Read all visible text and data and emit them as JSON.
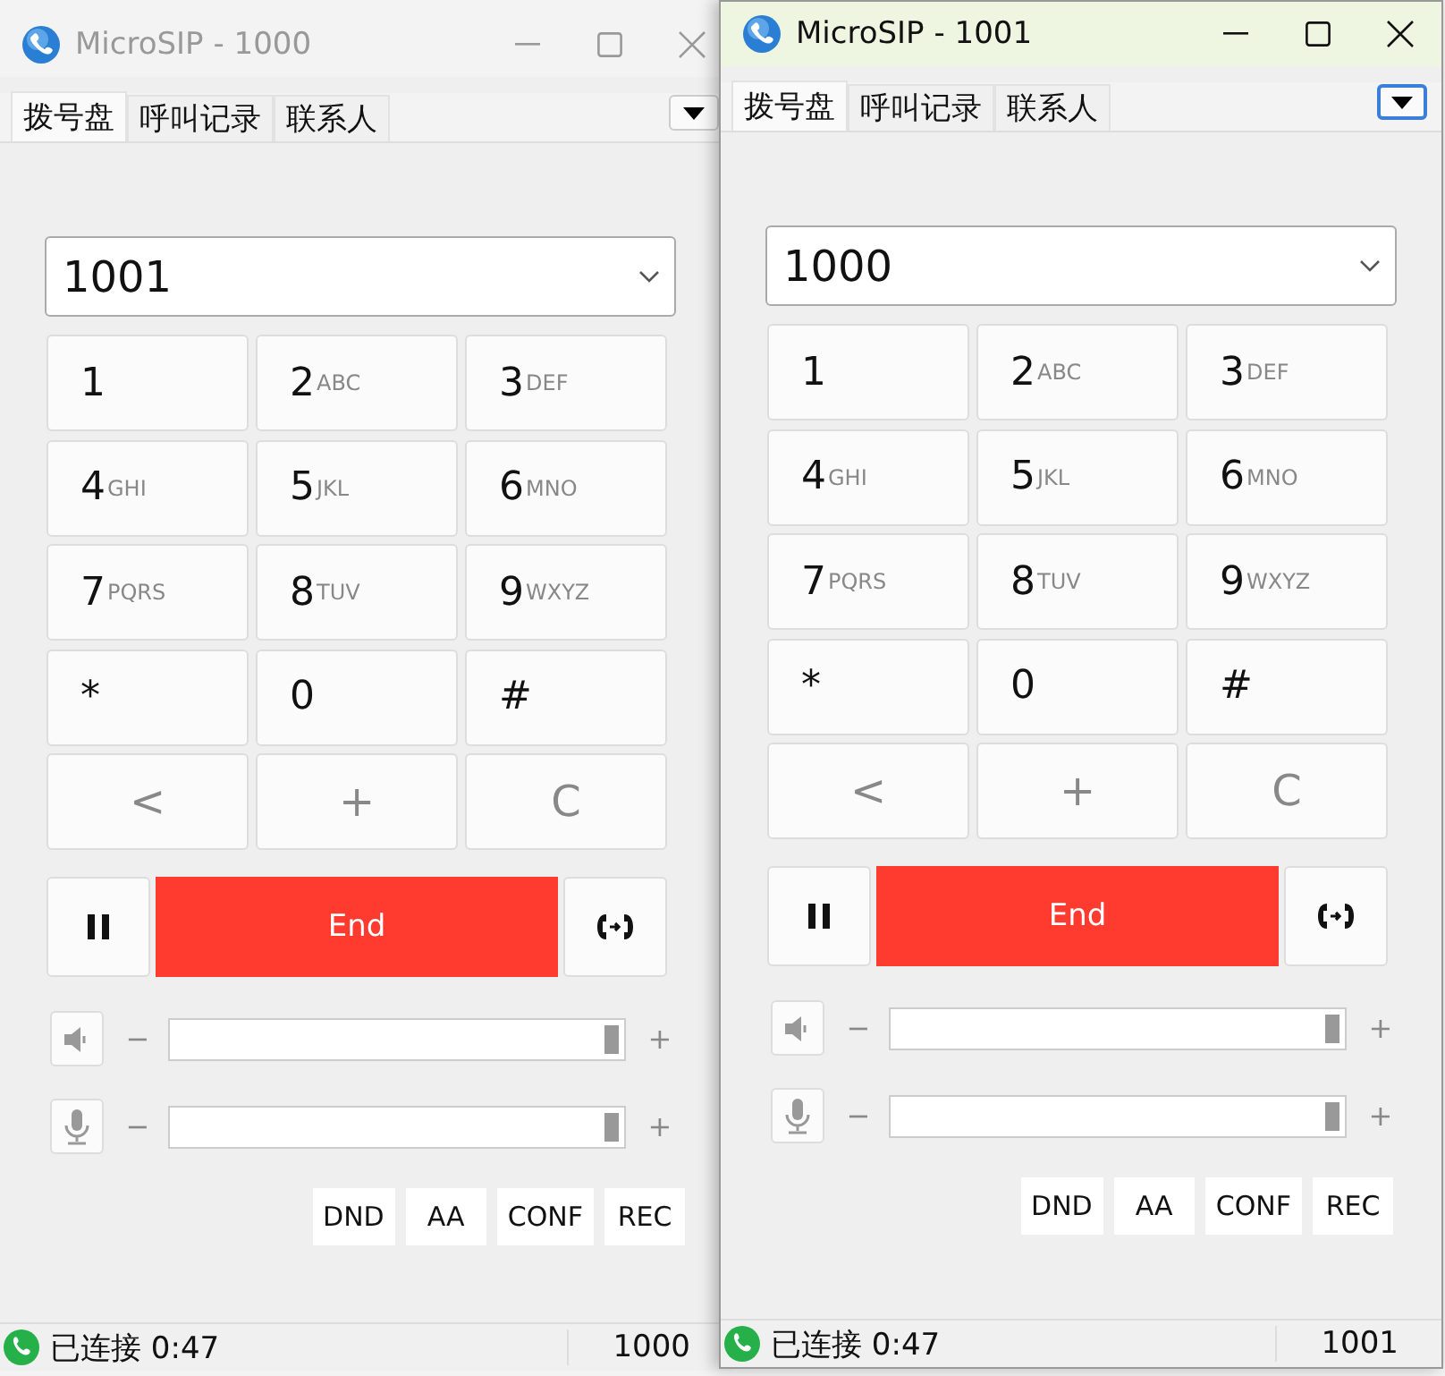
{
  "windows": [
    {
      "title": "MicroSIP - 1000",
      "active": false,
      "tabs": [
        {
          "label": "拨号盘",
          "selected": true
        },
        {
          "label": "呼叫记录",
          "selected": false
        },
        {
          "label": "联系人",
          "selected": false
        }
      ],
      "dial_input": {
        "value": "1001"
      },
      "keypad": [
        {
          "kind": "digit",
          "digit": "1"
        },
        {
          "kind": "digit",
          "digit": "2",
          "letters": "ABC"
        },
        {
          "kind": "digit",
          "digit": "3",
          "letters": "DEF"
        },
        {
          "kind": "digit",
          "digit": "4",
          "letters": "GHI"
        },
        {
          "kind": "digit",
          "digit": "5",
          "letters": "JKL"
        },
        {
          "kind": "digit",
          "digit": "6",
          "letters": "MNO"
        },
        {
          "kind": "digit",
          "digit": "7",
          "letters": "PQRS"
        },
        {
          "kind": "digit",
          "digit": "8",
          "letters": "TUV"
        },
        {
          "kind": "digit",
          "digit": "9",
          "letters": "WXYZ"
        },
        {
          "kind": "digit",
          "digit": "*"
        },
        {
          "kind": "digit",
          "digit": "0"
        },
        {
          "kind": "digit",
          "digit": "#"
        },
        {
          "kind": "function",
          "digit": "<"
        },
        {
          "kind": "function",
          "digit": "+"
        },
        {
          "kind": "function",
          "digit": "C"
        }
      ],
      "end_button": "End",
      "volumes": [
        {
          "kind": "speaker",
          "minus": "−",
          "plus": "+",
          "level": 1
        },
        {
          "kind": "microphone",
          "minus": "−",
          "plus": "+",
          "level": 1
        }
      ],
      "feature_buttons": [
        "DND",
        "AA",
        "CONF",
        "REC"
      ],
      "status": {
        "text": "已连接 0:47",
        "account": "1000"
      }
    },
    {
      "title": "MicroSIP - 1001",
      "active": true,
      "tabs": [
        {
          "label": "拨号盘",
          "selected": true
        },
        {
          "label": "呼叫记录",
          "selected": false
        },
        {
          "label": "联系人",
          "selected": false
        }
      ],
      "dial_input": {
        "value": "1000"
      },
      "keypad": [
        {
          "kind": "digit",
          "digit": "1"
        },
        {
          "kind": "digit",
          "digit": "2",
          "letters": "ABC"
        },
        {
          "kind": "digit",
          "digit": "3",
          "letters": "DEF"
        },
        {
          "kind": "digit",
          "digit": "4",
          "letters": "GHI"
        },
        {
          "kind": "digit",
          "digit": "5",
          "letters": "JKL"
        },
        {
          "kind": "digit",
          "digit": "6",
          "letters": "MNO"
        },
        {
          "kind": "digit",
          "digit": "7",
          "letters": "PQRS"
        },
        {
          "kind": "digit",
          "digit": "8",
          "letters": "TUV"
        },
        {
          "kind": "digit",
          "digit": "9",
          "letters": "WXYZ"
        },
        {
          "kind": "digit",
          "digit": "*"
        },
        {
          "kind": "digit",
          "digit": "0"
        },
        {
          "kind": "digit",
          "digit": "#"
        },
        {
          "kind": "function",
          "digit": "<"
        },
        {
          "kind": "function",
          "digit": "+"
        },
        {
          "kind": "function",
          "digit": "C"
        }
      ],
      "end_button": "End",
      "volumes": [
        {
          "kind": "speaker",
          "minus": "−",
          "plus": "+",
          "level": 1
        },
        {
          "kind": "microphone",
          "minus": "−",
          "plus": "+",
          "level": 1
        }
      ],
      "feature_buttons": [
        "DND",
        "AA",
        "CONF",
        "REC"
      ],
      "status": {
        "text": "已连接 0:47",
        "account": "1001"
      }
    }
  ]
}
